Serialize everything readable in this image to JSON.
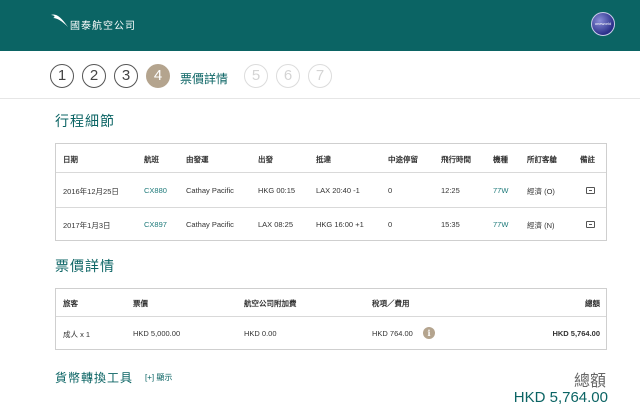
{
  "header": {
    "brand": "國泰航空公司",
    "alliance_badge": "oneworld",
    "colors": {
      "bar": "#0b6464",
      "accent": "#b4a48e"
    }
  },
  "steps": {
    "items": [
      "1",
      "2",
      "3",
      "4",
      "5",
      "6",
      "7"
    ],
    "current": "4",
    "current_label": "票價詳情"
  },
  "itinerary": {
    "title": "行程細節",
    "headers": [
      "日期",
      "航班",
      "由發運",
      "出發",
      "抵達",
      "中途停留",
      "飛行時間",
      "機種",
      "所訂客艙",
      "備註"
    ],
    "rows": [
      [
        "2016年12月25日",
        "CX880",
        "Cathay Pacific",
        "HKG 00:15",
        "LAX 20:40 -1",
        "0",
        "12:25",
        "77W",
        "經濟 (O)",
        "note-icon"
      ],
      [
        "2017年1月3日",
        "CX897",
        "Cathay Pacific",
        "LAX 08:25",
        "HKG 16:00 +1",
        "0",
        "15:35",
        "77W",
        "經濟 (N)",
        "note-icon"
      ]
    ]
  },
  "fare": {
    "title": "票價詳情",
    "headers": [
      "旅客",
      "票價",
      "航空公司附加費",
      "稅項／費用",
      "總額"
    ],
    "row": [
      "成人 x 1",
      "HKD 5,000.00",
      "HKD 0.00",
      "HKD 764.00",
      "HKD 5,764.00"
    ]
  },
  "converter": {
    "title": "貨幣轉換工具",
    "toggle": "[+] 顯示"
  },
  "total": {
    "label": "總額",
    "value": "HKD 5,764.00"
  }
}
